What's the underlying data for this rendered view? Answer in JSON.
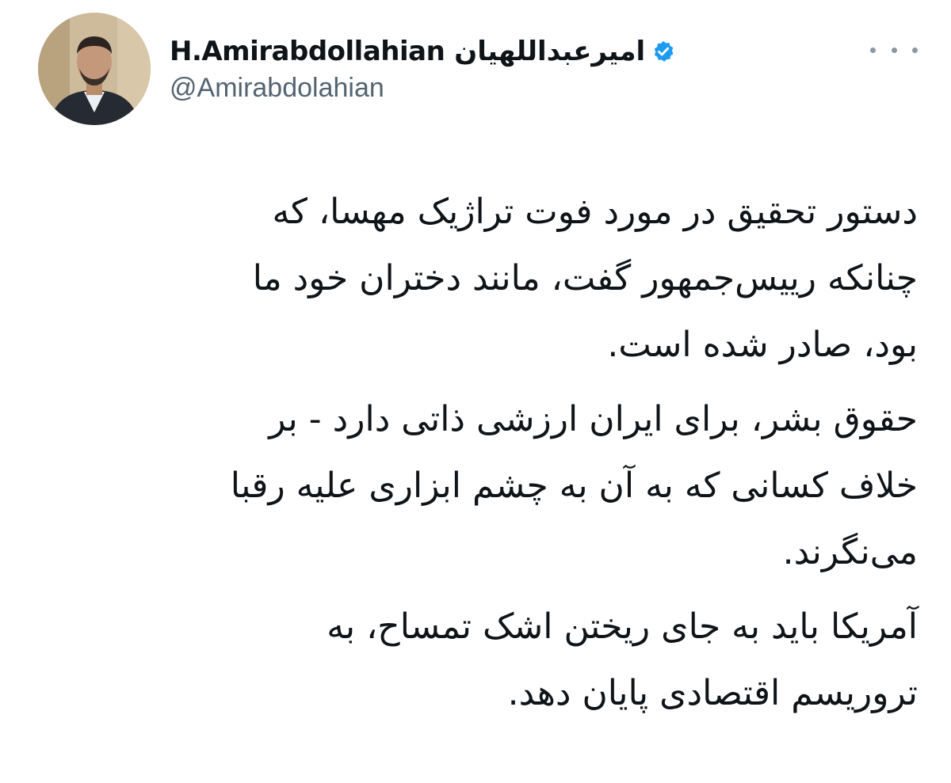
{
  "tweet": {
    "author": {
      "name_latin": "H.Amirabdollahian",
      "name_persian": "امیرعبداللهیان",
      "handle": "@Amirabdolahian",
      "verified": true
    },
    "paragraphs": [
      {
        "lines": [
          "دستور تحقیق در مورد فوت تراژیک مهسا، که",
          "چنانکه رییس‌جمهور گفت، مانند دختران خود ما",
          "بود، صادر شده است."
        ]
      },
      {
        "lines": [
          "حقوق بشر، برای ایران ارزشی ذاتی دارد - بر",
          "خلاف کسانی که به آن به چشم ابزاری علیه رقبا",
          "می‌نگرند."
        ]
      },
      {
        "lines": [
          "آمریکا باید به جای ریختن اشک تمساح، به",
          "تروریسم اقتصادی پایان دهد."
        ]
      }
    ]
  },
  "colors": {
    "text": "#0f1419",
    "secondary": "#536471",
    "verified_blue": "#1d9bf0",
    "more_dots": "#8b98a5"
  },
  "icons": {
    "verified": "verified-badge-icon",
    "more": "more-options-icon"
  }
}
